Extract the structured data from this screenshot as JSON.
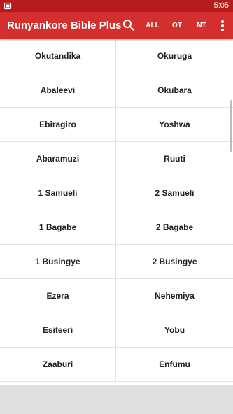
{
  "status_bar": {
    "time": "5:05"
  },
  "app_bar": {
    "title": "Runyankore Bible Plus",
    "tabs": [
      {
        "label": "ALL"
      },
      {
        "label": "OT"
      },
      {
        "label": "NT"
      }
    ]
  },
  "books": [
    [
      "Okutandika",
      "Okuruga"
    ],
    [
      "Abaleevi",
      "Okubara"
    ],
    [
      "Ebiragiro",
      "Yoshwa"
    ],
    [
      "Abaramuzi",
      "Ruuti"
    ],
    [
      "1 Samueli",
      "2 Samueli"
    ],
    [
      "1 Bagabe",
      "2 Bagabe"
    ],
    [
      "1 Busingye",
      "2 Busingye"
    ],
    [
      "Ezera",
      "Nehemiya"
    ],
    [
      "Esiteeri",
      "Yobu"
    ],
    [
      "Zaaburi",
      "Enfumu"
    ]
  ],
  "colors": {
    "status_bar": "#b71c1c",
    "app_bar": "#d32f2f",
    "text": "#222222",
    "divider": "#e3e3e3",
    "bottom_bar": "#e0e0e0"
  }
}
